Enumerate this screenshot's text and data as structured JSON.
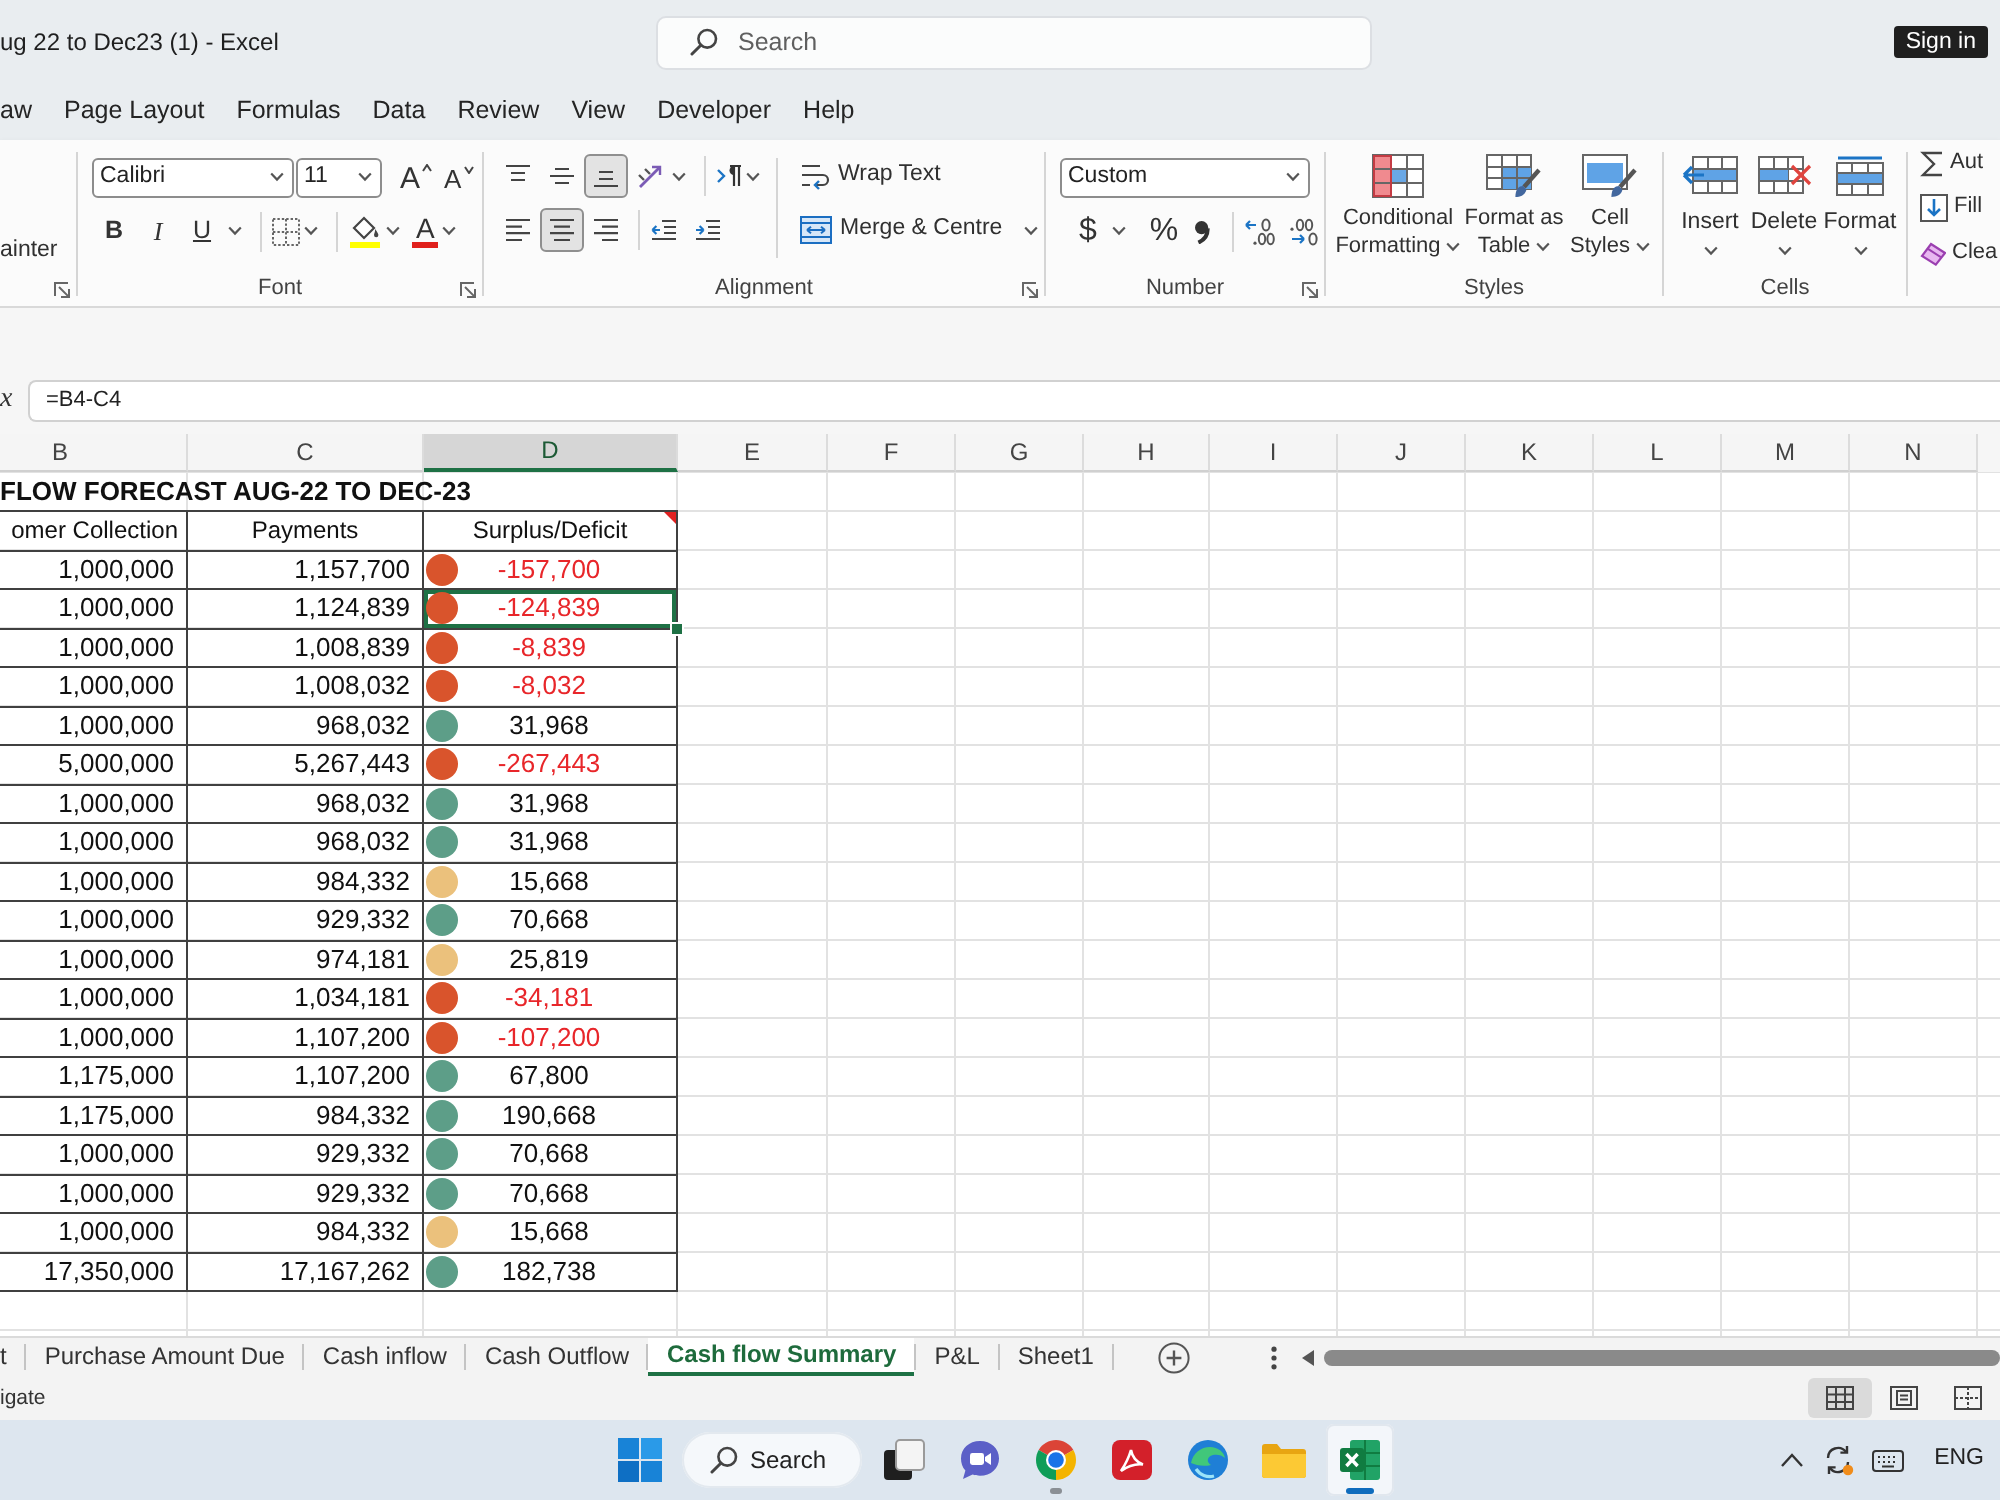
{
  "title_bar": {
    "title": "ug 22 to Dec23 (1)  -  Excel",
    "search_placeholder": "Search",
    "sign_in": "Sign in"
  },
  "menu_tabs": [
    {
      "label": "aw",
      "selected": false
    },
    {
      "label": "Page Layout",
      "selected": false
    },
    {
      "label": "Formulas",
      "selected": false
    },
    {
      "label": "Data",
      "selected": false
    },
    {
      "label": "Review",
      "selected": false
    },
    {
      "label": "View",
      "selected": false
    },
    {
      "label": "Developer",
      "selected": false
    },
    {
      "label": "Help",
      "selected": false
    }
  ],
  "ribbon": {
    "clipboard": {
      "painter": "ainter"
    },
    "font": {
      "font_name": "Calibri",
      "font_size": "11",
      "grow": "A",
      "shrink": "A",
      "bold": "B",
      "italic": "I",
      "underline": "U",
      "font_color": "A",
      "label": "Font"
    },
    "alignment": {
      "vertical": [
        {
          "kind": "top",
          "selected": false
        },
        {
          "kind": "middle",
          "selected": false
        },
        {
          "kind": "bottom",
          "selected": true
        }
      ],
      "horizontal": [
        {
          "kind": "left",
          "selected": false
        },
        {
          "kind": "center",
          "selected": true
        },
        {
          "kind": "right",
          "selected": false
        }
      ],
      "wrap_text": "Wrap Text",
      "merge": "Merge & Centre",
      "label": "Alignment"
    },
    "number": {
      "format": "Custom",
      "currency": "$",
      "percent": "%",
      "label": "Number"
    },
    "styles": {
      "buttons": [
        {
          "kind": "conditional",
          "label": "Conditional Formatting"
        },
        {
          "kind": "table",
          "label": "Format as Table"
        },
        {
          "kind": "cell",
          "label": "Cell Styles"
        }
      ],
      "label": "Styles"
    },
    "cells": {
      "buttons": [
        {
          "kind": "insert",
          "label": "Insert"
        },
        {
          "kind": "delete",
          "label": "Delete"
        },
        {
          "kind": "format",
          "label": "Format"
        }
      ],
      "label": "Cells"
    },
    "editing": {
      "buttons": [
        {
          "kind": "sum",
          "label": "Aut"
        },
        {
          "kind": "fill",
          "label": "Fill"
        },
        {
          "kind": "clear",
          "label": "Clea"
        }
      ]
    }
  },
  "formula_bar": {
    "function_label": "x",
    "formula": "=B4-C4"
  },
  "sheet": {
    "columns": [
      {
        "label": "B",
        "selected": false
      },
      {
        "label": "C",
        "selected": false
      },
      {
        "label": "D",
        "selected": true
      },
      {
        "label": "E",
        "selected": false
      },
      {
        "label": "F",
        "selected": false
      },
      {
        "label": "G",
        "selected": false
      },
      {
        "label": "H",
        "selected": false
      },
      {
        "label": "I",
        "selected": false
      },
      {
        "label": "J",
        "selected": false
      },
      {
        "label": "K",
        "selected": false
      },
      {
        "label": "L",
        "selected": false
      },
      {
        "label": "M",
        "selected": false
      },
      {
        "label": "N",
        "selected": false
      }
    ],
    "title": "FLOW FORECAST AUG-22 TO DEC-23",
    "headers": [
      {
        "text": "omer Collection",
        "comment": false
      },
      {
        "text": "Payments",
        "comment": false
      },
      {
        "text": "Surplus/Deficit",
        "comment": true
      }
    ],
    "rows": [
      {
        "collection": "1,000,000",
        "payments": "1,157,700",
        "color": "#d9542c",
        "surplus": "-157,700",
        "negative": true,
        "selected": false
      },
      {
        "collection": "1,000,000",
        "payments": "1,124,839",
        "color": "#d9542c",
        "surplus": "-124,839",
        "negative": true,
        "selected": true
      },
      {
        "collection": "1,000,000",
        "payments": "1,008,839",
        "color": "#d9542c",
        "surplus": "-8,839",
        "negative": true,
        "selected": false
      },
      {
        "collection": "1,000,000",
        "payments": "1,008,032",
        "color": "#d9542c",
        "surplus": "-8,032",
        "negative": true,
        "selected": false
      },
      {
        "collection": "1,000,000",
        "payments": "968,032",
        "color": "#5d9e88",
        "surplus": "31,968",
        "negative": false,
        "selected": false
      },
      {
        "collection": "5,000,000",
        "payments": "5,267,443",
        "color": "#d9542c",
        "surplus": "-267,443",
        "negative": true,
        "selected": false
      },
      {
        "collection": "1,000,000",
        "payments": "968,032",
        "color": "#5d9e88",
        "surplus": "31,968",
        "negative": false,
        "selected": false
      },
      {
        "collection": "1,000,000",
        "payments": "968,032",
        "color": "#5d9e88",
        "surplus": "31,968",
        "negative": false,
        "selected": false
      },
      {
        "collection": "1,000,000",
        "payments": "984,332",
        "color": "#ebc17c",
        "surplus": "15,668",
        "negative": false,
        "selected": false
      },
      {
        "collection": "1,000,000",
        "payments": "929,332",
        "color": "#5d9e88",
        "surplus": "70,668",
        "negative": false,
        "selected": false
      },
      {
        "collection": "1,000,000",
        "payments": "974,181",
        "color": "#ebc17c",
        "surplus": "25,819",
        "negative": false,
        "selected": false
      },
      {
        "collection": "1,000,000",
        "payments": "1,034,181",
        "color": "#d9542c",
        "surplus": "-34,181",
        "negative": true,
        "selected": false
      },
      {
        "collection": "1,000,000",
        "payments": "1,107,200",
        "color": "#d9542c",
        "surplus": "-107,200",
        "negative": true,
        "selected": false
      },
      {
        "collection": "1,175,000",
        "payments": "1,107,200",
        "color": "#5d9e88",
        "surplus": "67,800",
        "negative": false,
        "selected": false
      },
      {
        "collection": "1,175,000",
        "payments": "984,332",
        "color": "#5d9e88",
        "surplus": "190,668",
        "negative": false,
        "selected": false
      },
      {
        "collection": "1,000,000",
        "payments": "929,332",
        "color": "#5d9e88",
        "surplus": "70,668",
        "negative": false,
        "selected": false
      },
      {
        "collection": "1,000,000",
        "payments": "929,332",
        "color": "#5d9e88",
        "surplus": "70,668",
        "negative": false,
        "selected": false
      },
      {
        "collection": "1,000,000",
        "payments": "984,332",
        "color": "#ebc17c",
        "surplus": "15,668",
        "negative": false,
        "selected": false
      },
      {
        "collection": "17,350,000",
        "payments": "17,167,262",
        "color": "#5d9e88",
        "surplus": "182,738",
        "negative": false,
        "selected": false
      }
    ]
  },
  "sheet_tabs": [
    {
      "label": "t",
      "selected": false
    },
    {
      "label": "Purchase Amount Due",
      "selected": false
    },
    {
      "label": "Cash inflow",
      "selected": false
    },
    {
      "label": "Cash Outflow",
      "selected": false
    },
    {
      "label": "Cash flow Summary",
      "selected": true
    },
    {
      "label": "P&L",
      "selected": false
    },
    {
      "label": "Sheet1",
      "selected": false
    }
  ],
  "status_bar": {
    "text": "igate",
    "views": [
      {
        "kind": "normal",
        "selected": true
      },
      {
        "kind": "page_layout",
        "selected": false
      },
      {
        "kind": "page_break",
        "selected": false
      }
    ]
  },
  "taskbar": {
    "search": "Search",
    "apps": [
      {
        "kind": "task_view",
        "running": false,
        "selected": false
      },
      {
        "kind": "chat",
        "running": false,
        "selected": false
      },
      {
        "kind": "ring_browser",
        "running": true,
        "selected": false
      },
      {
        "kind": "pdf",
        "running": false,
        "selected": false
      },
      {
        "kind": "wave_browser",
        "running": false,
        "selected": false
      },
      {
        "kind": "folder",
        "running": false,
        "selected": false
      },
      {
        "kind": "spreadsheet",
        "running": true,
        "selected": true
      }
    ],
    "language": "ENG"
  }
}
